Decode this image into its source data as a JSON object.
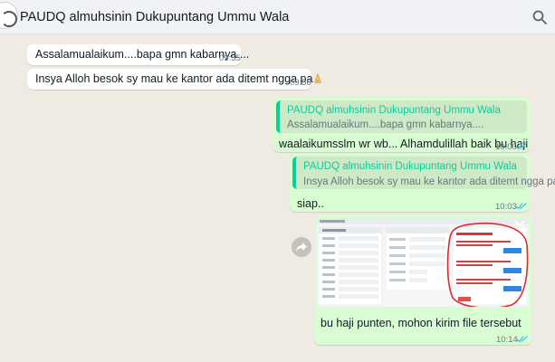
{
  "header": {
    "title": "PAUDQ almuhsinin Dukupuntang Ummu Wala"
  },
  "messages": [
    {
      "text": "Assalamualaikum....bapa gmn kabarnya....",
      "time": "09:55"
    },
    {
      "text": "Insya Alloh besok sy mau ke kantor ada ditemt ngga pa",
      "time": "09:56"
    },
    {
      "quote_author": "PAUDQ almuhsinin Dukupuntang Ummu Wala",
      "quote_text": "Assalamualaikum....bapa gmn kabarnya....",
      "text": "waalaikumsslm wr wb... Alhamdulillah baik bu haji",
      "time": "10:00"
    },
    {
      "quote_author": "PAUDQ almuhsinin Dukupuntang Ummu Wala",
      "quote_text": "Insya Alloh besok sy mau ke kantor ada ditemt ngga pa",
      "text": "siap..",
      "time": "10:03"
    },
    {
      "caption": "bu haji punten, mohon kirim file tersebut",
      "time": "10:14"
    }
  ],
  "colors": {
    "outgoing": "#d9fdd3",
    "incoming": "#ffffff",
    "quote_accent": "#06cf9c",
    "read_ticks": "#53bdeb",
    "circle_mark": "#e0282e"
  },
  "icons": {
    "search": "search-icon",
    "forward": "forward-icon",
    "ticks": "double-check-icon",
    "avatar": "avatar",
    "emoji": "folded-hands-emoji",
    "chevron": "chevron-down-icon"
  }
}
